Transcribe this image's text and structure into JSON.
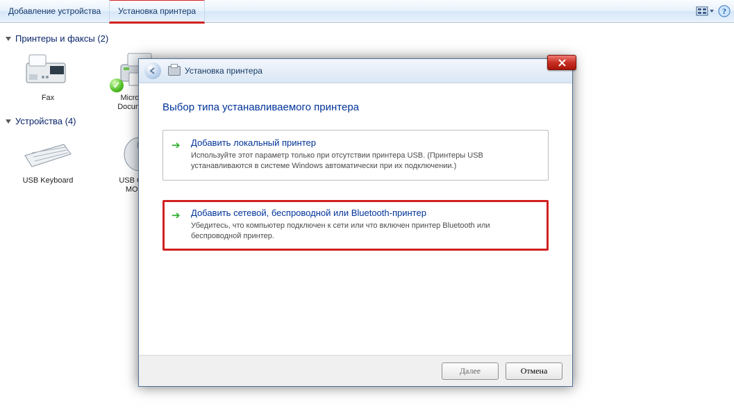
{
  "cmdbar": {
    "add_device": "Добавление устройства",
    "add_printer": "Установка принтера"
  },
  "groups": {
    "printers": {
      "title": "Принтеры и факсы (2)",
      "items": [
        {
          "label": "Fax"
        },
        {
          "label": "Microsoft X\nDocument W"
        }
      ]
    },
    "devices": {
      "title": "Устройства (4)",
      "items": [
        {
          "label": "USB Keyboard"
        },
        {
          "label": "USB OPTIC\nMOUSE"
        }
      ]
    }
  },
  "dialog": {
    "title": "Установка принтера",
    "heading": "Выбор типа устанавливаемого принтера",
    "option_local": {
      "title": "Добавить локальный принтер",
      "desc": "Используйте этот параметр только при отсутствии принтера USB. (Принтеры USB устанавливаются в системе Windows автоматически при их подключении.)"
    },
    "option_net": {
      "title": "Добавить сетевой, беспроводной или Bluetooth-принтер",
      "desc": "Убедитесь, что компьютер подключен к сети или что включен принтер Bluetooth или беспроводной принтер."
    },
    "btn_next": "Далее",
    "btn_cancel": "Отмена"
  }
}
